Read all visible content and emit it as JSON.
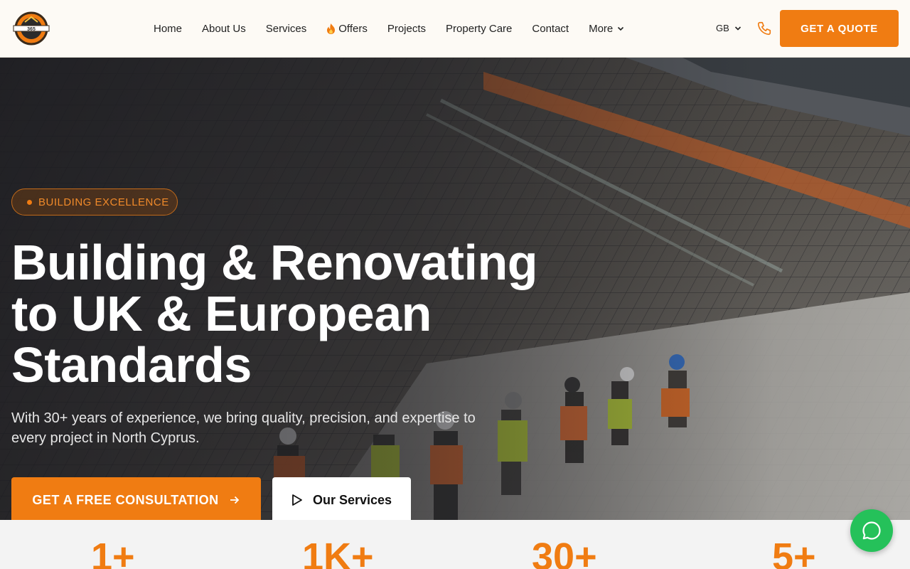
{
  "header": {
    "logo_text": "365",
    "nav": [
      {
        "label": "Home"
      },
      {
        "label": "About Us"
      },
      {
        "label": "Services"
      },
      {
        "label": "Offers",
        "icon": "fire-icon"
      },
      {
        "label": "Projects"
      },
      {
        "label": "Property Care"
      },
      {
        "label": "Contact"
      },
      {
        "label": "More",
        "icon": "chevron-down-icon"
      }
    ],
    "language": "GB",
    "quote_label": "GET A QUOTE"
  },
  "hero": {
    "badge": "BUILDING EXCELLENCE",
    "title_lines": [
      "Building & Renovating",
      "to UK & European",
      "Standards"
    ],
    "subtitle": "With 30+ years of experience, we bring quality, precision, and expertise to every project in North Cyprus.",
    "primary_cta": "GET A FREE CONSULTATION",
    "secondary_cta": "Our Services"
  },
  "stats": [
    "1+",
    "1K+",
    "30+",
    "5+"
  ],
  "colors": {
    "accent": "#f07c12",
    "whatsapp": "#25c15a",
    "header_bg": "#fdfaf5"
  }
}
